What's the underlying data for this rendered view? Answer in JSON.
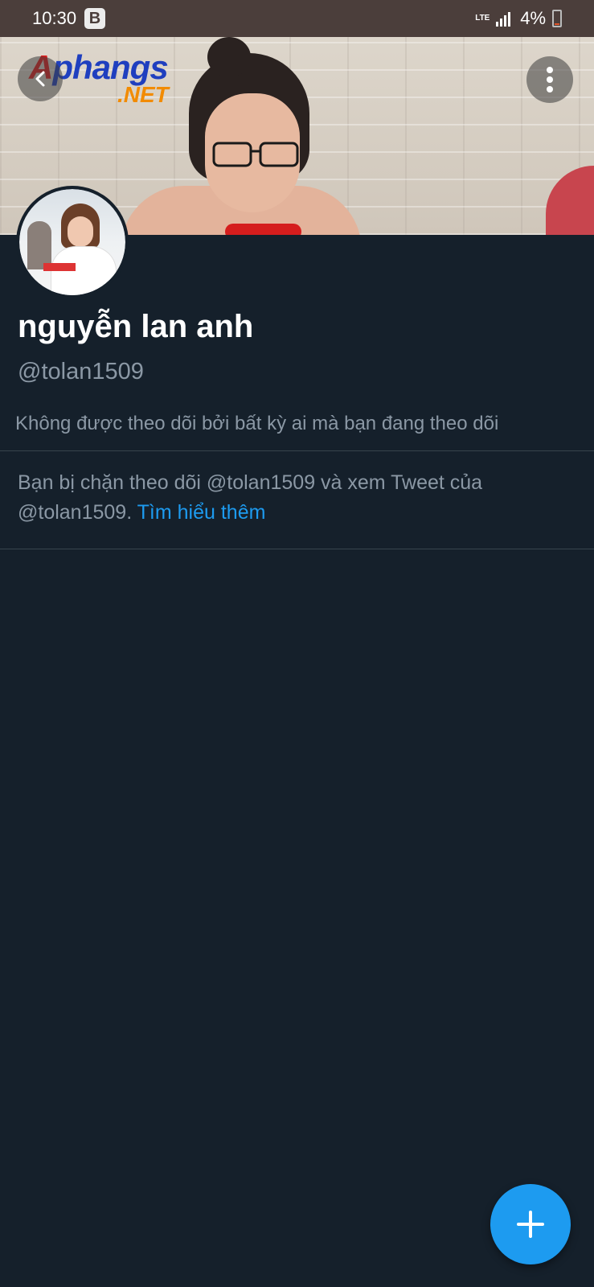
{
  "status_bar": {
    "time": "10:30",
    "app_badge": "B",
    "network": "LTE",
    "battery": "4%"
  },
  "banner": {
    "watermark_main_first": "A",
    "watermark_main_rest": "phangs",
    "watermark_sub": ".NET"
  },
  "profile": {
    "display_name": "nguyễn lan anh",
    "handle": "@tolan1509",
    "followed_note": "Không được theo dõi bởi bất kỳ ai mà bạn đang theo dõi"
  },
  "blocked": {
    "text": "Bạn bị chặn theo dõi @tolan1509 và xem Tweet của @tolan1509. ",
    "link": "Tìm hiểu thêm"
  },
  "icons": {
    "back": "back-arrow-icon",
    "more": "more-vertical-icon",
    "fab": "plus-icon"
  },
  "colors": {
    "background": "#15202b",
    "accent": "#1d9bf0",
    "secondary_text": "#8b98a5",
    "divider": "#38444d"
  }
}
